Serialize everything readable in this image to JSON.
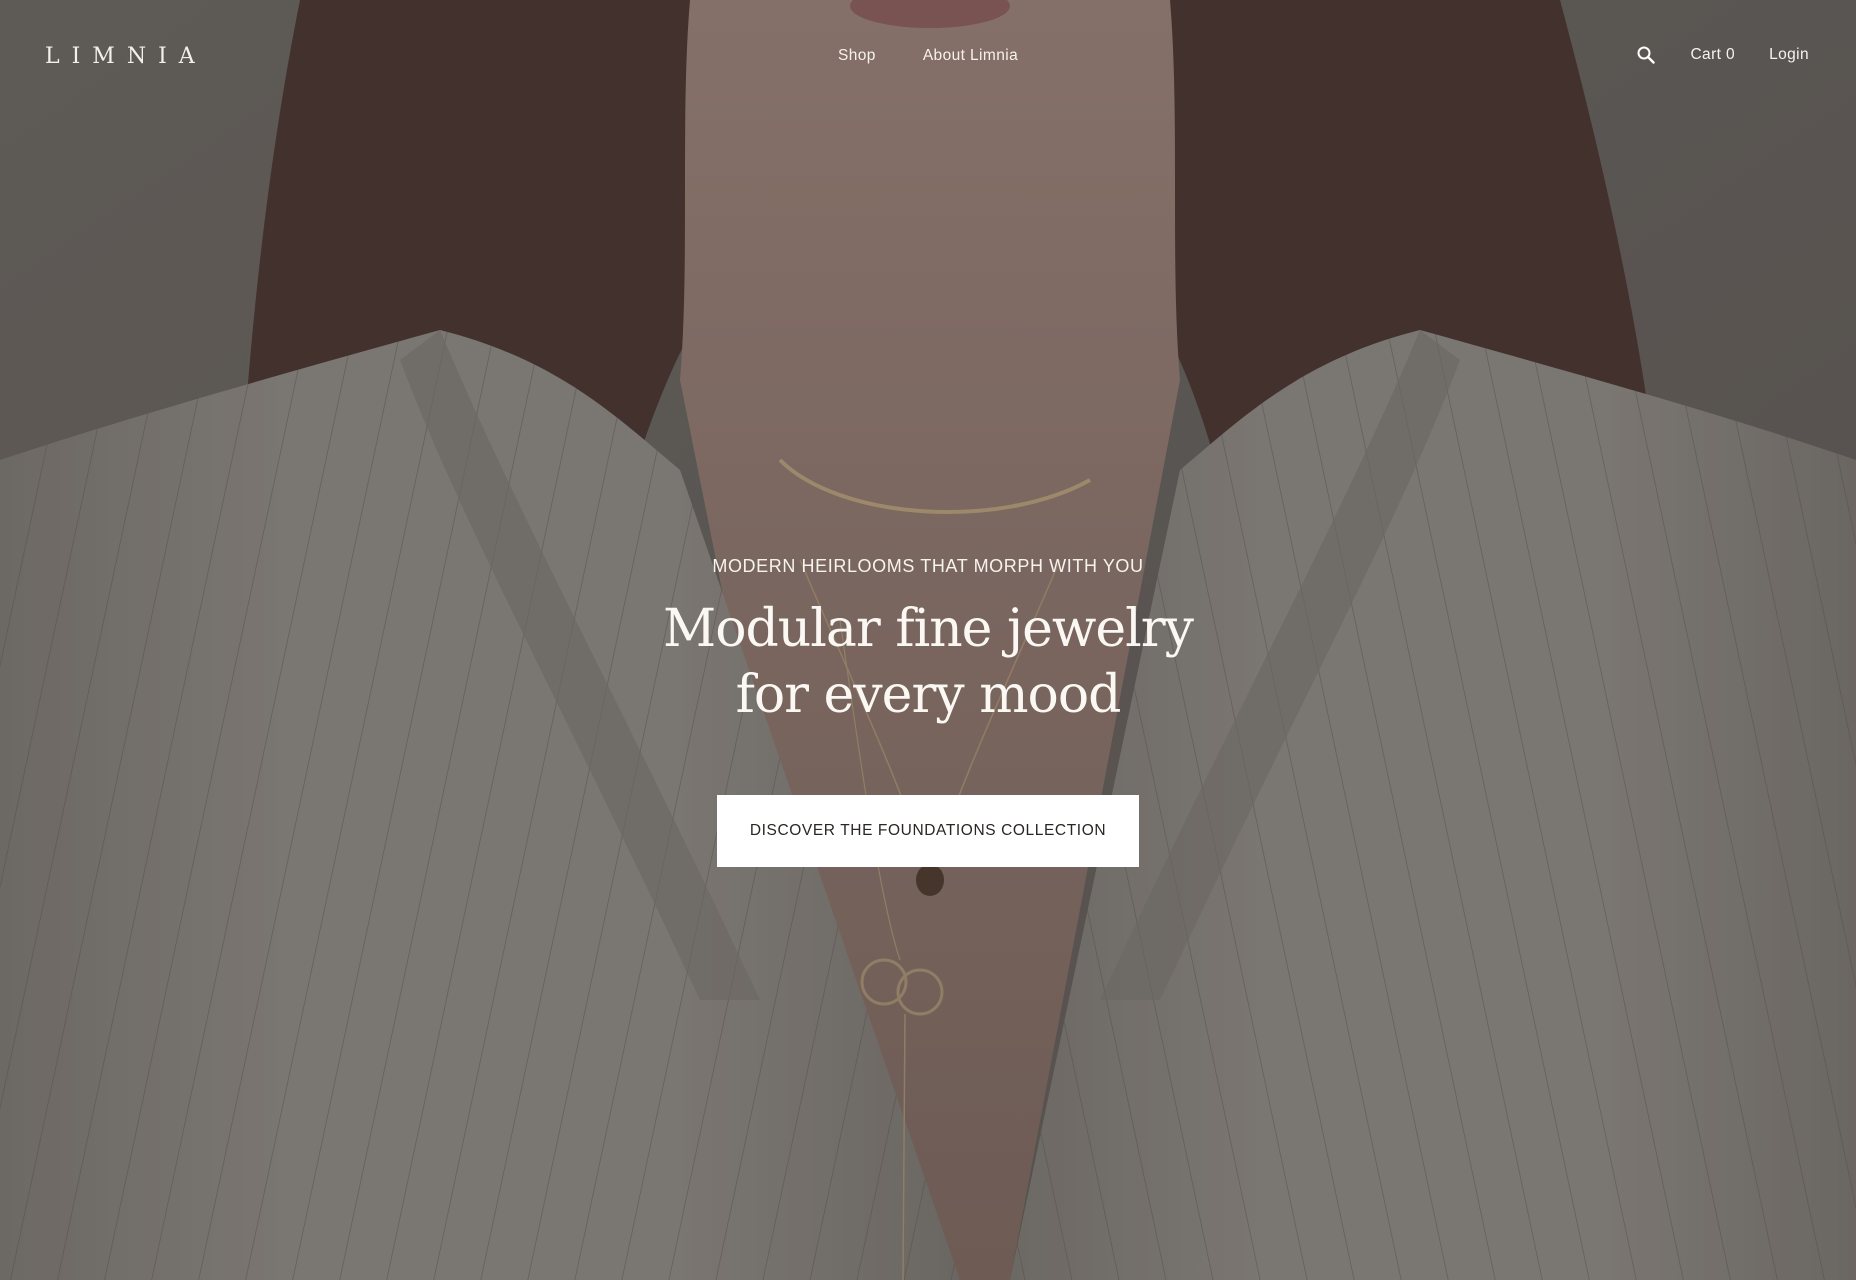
{
  "header": {
    "logo": "LIMNIA",
    "nav": [
      {
        "label": "Shop"
      },
      {
        "label": "About Limnia"
      }
    ],
    "search_icon": "search-icon",
    "cart_label": "Cart 0",
    "login_label": "Login"
  },
  "hero": {
    "eyebrow": "MODERN HEIRLOOMS THAT MORPH WITH YOU",
    "headline_line1": "Modular fine jewelry",
    "headline_line2": "for every mood",
    "cta_label": "DISCOVER THE FOUNDATIONS COLLECTION"
  },
  "colors": {
    "overlay_text": "#ffffff",
    "cta_background": "#ffffff",
    "cta_text": "#2a2623"
  }
}
